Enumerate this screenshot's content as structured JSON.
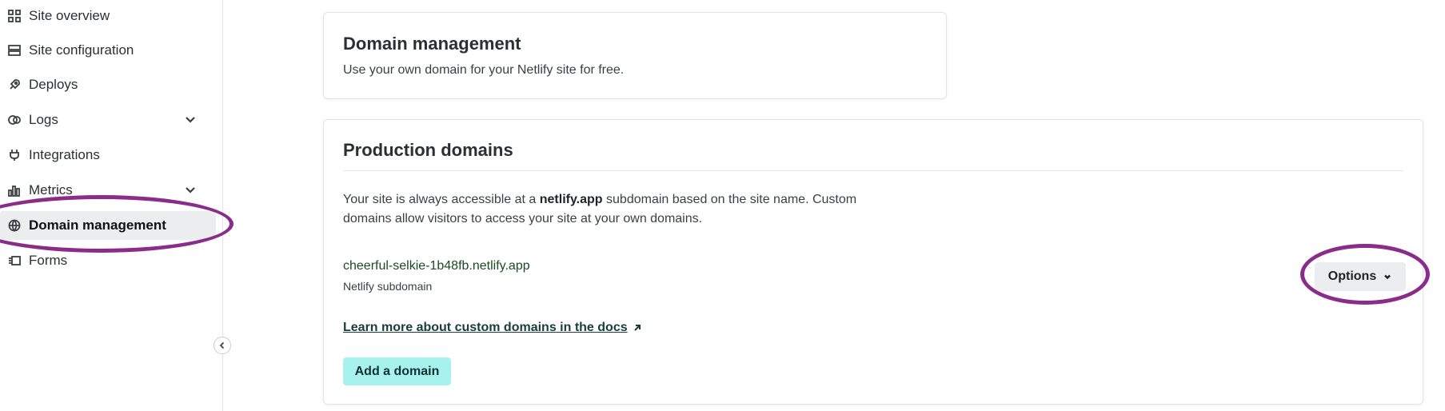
{
  "sidebar": {
    "items": [
      {
        "label": "Site overview",
        "icon": "grid-icon"
      },
      {
        "label": "Site configuration",
        "icon": "config-icon"
      },
      {
        "label": "Deploys",
        "icon": "rocket-icon"
      },
      {
        "label": "Logs",
        "icon": "logs-icon",
        "expandable": true
      },
      {
        "label": "Integrations",
        "icon": "plug-icon"
      },
      {
        "label": "Metrics",
        "icon": "bar-chart-icon",
        "expandable": true
      },
      {
        "label": "Domain management",
        "icon": "globe-icon",
        "active": true
      },
      {
        "label": "Forms",
        "icon": "forms-icon"
      }
    ]
  },
  "domain_card": {
    "title": "Domain management",
    "description": "Use your own domain for your Netlify site for free."
  },
  "production": {
    "title": "Production domains",
    "text_before": "Your site is always accessible at a ",
    "text_bold": "netlify.app",
    "text_after": " subdomain based on the site name. Custom domains allow visitors to access your site at your own domains.",
    "domain": "cheerful-selkie-1b48fb.netlify.app",
    "domain_type": "Netlify subdomain",
    "options_label": "Options",
    "docs_link": "Learn more about custom domains in the docs",
    "add_button": "Add a domain"
  },
  "colors": {
    "accent_teal": "#a8f2ee",
    "annotation_purple": "#8a2d8a",
    "active_nav_bg": "#ebedef"
  }
}
